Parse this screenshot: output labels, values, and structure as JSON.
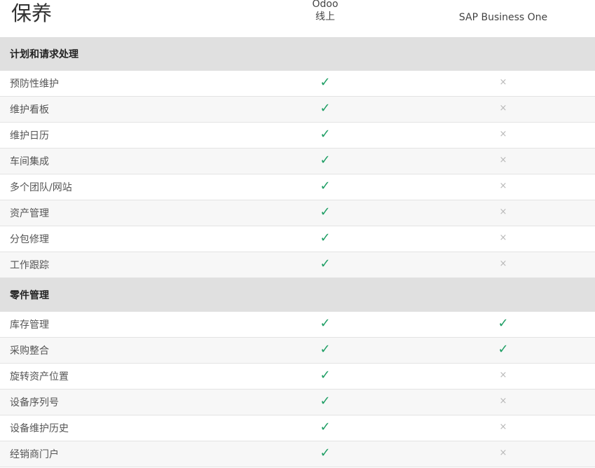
{
  "header": {
    "title": "保养",
    "odoo_line1": "Odoo",
    "odoo_line2": "线上",
    "competitor": "SAP Business One"
  },
  "icons": {
    "yes": "✓",
    "no": "×",
    "yes_color": "#1e9e64",
    "no_color": "#b8b8b8"
  },
  "sections": [
    {
      "title": "计划和请求处理",
      "rows": [
        {
          "feature": "预防性维护",
          "odoo": true,
          "sap": false
        },
        {
          "feature": "维护看板",
          "odoo": true,
          "sap": false
        },
        {
          "feature": "维护日历",
          "odoo": true,
          "sap": false
        },
        {
          "feature": "车间集成",
          "odoo": true,
          "sap": false
        },
        {
          "feature": "多个团队/网站",
          "odoo": true,
          "sap": false
        },
        {
          "feature": "资产管理",
          "odoo": true,
          "sap": false
        },
        {
          "feature": "分包修理",
          "odoo": true,
          "sap": false
        },
        {
          "feature": "工作跟踪",
          "odoo": true,
          "sap": false
        }
      ]
    },
    {
      "title": "零件管理",
      "rows": [
        {
          "feature": "库存管理",
          "odoo": true,
          "sap": true
        },
        {
          "feature": "采购整合",
          "odoo": true,
          "sap": true
        },
        {
          "feature": "旋转资产位置",
          "odoo": true,
          "sap": false
        },
        {
          "feature": "设备序列号",
          "odoo": true,
          "sap": false
        },
        {
          "feature": "设备维护历史",
          "odoo": true,
          "sap": false
        },
        {
          "feature": "经销商门户",
          "odoo": true,
          "sap": false
        }
      ]
    }
  ]
}
